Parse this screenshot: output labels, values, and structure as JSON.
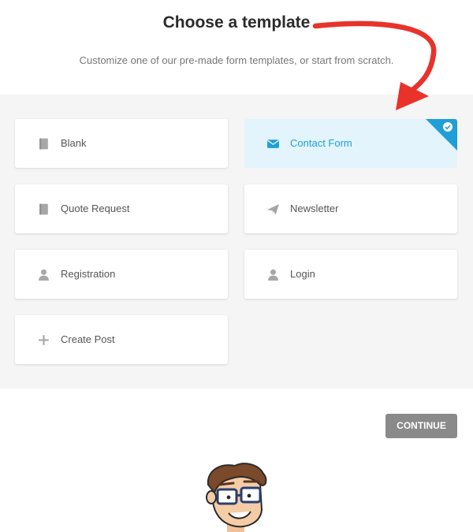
{
  "header": {
    "title": "Choose a template",
    "subtitle": "Customize one of our pre-made form templates, or start from scratch."
  },
  "templates": [
    {
      "label": "Blank",
      "icon": "book-icon",
      "selected": false
    },
    {
      "label": "Contact Form",
      "icon": "envelope-icon",
      "selected": true
    },
    {
      "label": "Quote Request",
      "icon": "book-icon",
      "selected": false
    },
    {
      "label": "Newsletter",
      "icon": "paper-plane-icon",
      "selected": false
    },
    {
      "label": "Registration",
      "icon": "user-icon",
      "selected": false
    },
    {
      "label": "Login",
      "icon": "user-icon",
      "selected": false
    },
    {
      "label": "Create Post",
      "icon": "plus-icon",
      "selected": false
    }
  ],
  "actions": {
    "continue_label": "CONTINUE"
  },
  "colors": {
    "accent": "#1f9ed7",
    "selected_bg": "#e3f4fc",
    "annotation_arrow": "#e8322a",
    "button_bg": "#8a8a8a",
    "panel_bg": "#f5f5f5"
  }
}
